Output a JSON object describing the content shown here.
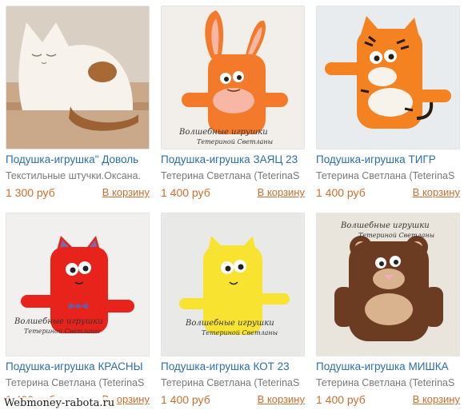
{
  "products": [
    {
      "title": "Подушка-игрушка\" Доволь",
      "shop": "Текстильные штучки.Оксана.",
      "price": "1 300 руб",
      "cart_label": "В корзину",
      "image_icon": "white-cat-pillow",
      "color": "#f5efe8"
    },
    {
      "title": "Подушка-игрушка ЗАЯЦ 23",
      "shop": "Тетерина Светлана (TeterinaS",
      "price": "1 400 руб",
      "cart_label": "В корзину",
      "image_icon": "orange-bunny-toy",
      "color": "#f47a2b"
    },
    {
      "title": "Подушка-игрушка ТИГР",
      "shop": "Тетерина Светлана (TeterinaS",
      "price": "1 400 руб",
      "cart_label": "В корзину",
      "image_icon": "orange-tiger-toy",
      "color": "#f58220"
    },
    {
      "title": "Подушка-игрушка КРАСНЫ",
      "shop": "Тетерина Светлана (TeterinaS",
      "price": "1 400 руб",
      "cart_label": "В корзину",
      "image_icon": "red-cat-toy",
      "color": "#e8231b"
    },
    {
      "title": "Подушка-игрушка КОТ 23",
      "shop": "Тетерина Светлана (TeterinaS",
      "price": "1 400 руб",
      "cart_label": "В корзину",
      "image_icon": "yellow-cat-toy",
      "color": "#f7e330"
    },
    {
      "title": "Подушка-игрушка МИШКА",
      "shop": "Тетерина Светлана (TeterinaS",
      "price": "1 400 руб",
      "cart_label": "В корзину",
      "image_icon": "brown-bear-toy",
      "color": "#6b3b22"
    }
  ],
  "signatures": {
    "line1": "Волшебные игрушки",
    "line2": "Тетериной Светланы"
  },
  "watermark": "Webmoney-rabota.ru",
  "colors": {
    "link": "#2d6ea8",
    "price": "#cc6e2e",
    "muted": "#7a7a7a"
  }
}
